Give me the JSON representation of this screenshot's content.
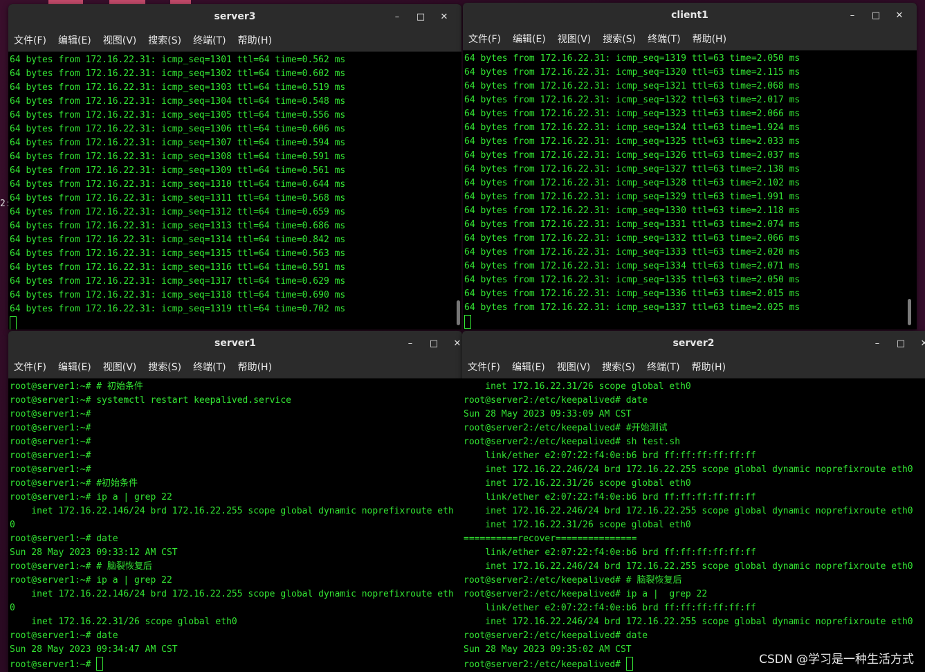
{
  "menu": [
    "文件(F)",
    "编辑(E)",
    "视图(V)",
    "搜索(S)",
    "终端(T)",
    "帮助(H)"
  ],
  "controls": {
    "minimize": "–",
    "maximize": "□",
    "close": "✕"
  },
  "stray_char": "2:",
  "watermark": "CSDN @学习是一种生活方式",
  "windows": {
    "server3": {
      "title": "server3",
      "lines": [
        "64 bytes from 172.16.22.31: icmp_seq=1301 ttl=64 time=0.562 ms",
        "64 bytes from 172.16.22.31: icmp_seq=1302 ttl=64 time=0.602 ms",
        "64 bytes from 172.16.22.31: icmp_seq=1303 ttl=64 time=0.519 ms",
        "64 bytes from 172.16.22.31: icmp_seq=1304 ttl=64 time=0.548 ms",
        "64 bytes from 172.16.22.31: icmp_seq=1305 ttl=64 time=0.556 ms",
        "64 bytes from 172.16.22.31: icmp_seq=1306 ttl=64 time=0.606 ms",
        "64 bytes from 172.16.22.31: icmp_seq=1307 ttl=64 time=0.594 ms",
        "64 bytes from 172.16.22.31: icmp_seq=1308 ttl=64 time=0.591 ms",
        "64 bytes from 172.16.22.31: icmp_seq=1309 ttl=64 time=0.561 ms",
        "64 bytes from 172.16.22.31: icmp_seq=1310 ttl=64 time=0.644 ms",
        "64 bytes from 172.16.22.31: icmp_seq=1311 ttl=64 time=0.568 ms",
        "64 bytes from 172.16.22.31: icmp_seq=1312 ttl=64 time=0.659 ms",
        "64 bytes from 172.16.22.31: icmp_seq=1313 ttl=64 time=0.686 ms",
        "64 bytes from 172.16.22.31: icmp_seq=1314 ttl=64 time=0.842 ms",
        "64 bytes from 172.16.22.31: icmp_seq=1315 ttl=64 time=0.563 ms",
        "64 bytes from 172.16.22.31: icmp_seq=1316 ttl=64 time=0.591 ms",
        "64 bytes from 172.16.22.31: icmp_seq=1317 ttl=64 time=0.629 ms",
        "64 bytes from 172.16.22.31: icmp_seq=1318 ttl=64 time=0.690 ms",
        "64 bytes from 172.16.22.31: icmp_seq=1319 ttl=64 time=0.702 ms"
      ],
      "prompt": ""
    },
    "client1": {
      "title": "client1",
      "lines": [
        "64 bytes from 172.16.22.31: icmp_seq=1319 ttl=63 time=2.050 ms",
        "64 bytes from 172.16.22.31: icmp_seq=1320 ttl=63 time=2.115 ms",
        "64 bytes from 172.16.22.31: icmp_seq=1321 ttl=63 time=2.068 ms",
        "64 bytes from 172.16.22.31: icmp_seq=1322 ttl=63 time=2.017 ms",
        "64 bytes from 172.16.22.31: icmp_seq=1323 ttl=63 time=2.066 ms",
        "64 bytes from 172.16.22.31: icmp_seq=1324 ttl=63 time=1.924 ms",
        "64 bytes from 172.16.22.31: icmp_seq=1325 ttl=63 time=2.033 ms",
        "64 bytes from 172.16.22.31: icmp_seq=1326 ttl=63 time=2.037 ms",
        "64 bytes from 172.16.22.31: icmp_seq=1327 ttl=63 time=2.138 ms",
        "64 bytes from 172.16.22.31: icmp_seq=1328 ttl=63 time=2.102 ms",
        "64 bytes from 172.16.22.31: icmp_seq=1329 ttl=63 time=1.991 ms",
        "64 bytes from 172.16.22.31: icmp_seq=1330 ttl=63 time=2.118 ms",
        "64 bytes from 172.16.22.31: icmp_seq=1331 ttl=63 time=2.074 ms",
        "64 bytes from 172.16.22.31: icmp_seq=1332 ttl=63 time=2.066 ms",
        "64 bytes from 172.16.22.31: icmp_seq=1333 ttl=63 time=2.020 ms",
        "64 bytes from 172.16.22.31: icmp_seq=1334 ttl=63 time=2.071 ms",
        "64 bytes from 172.16.22.31: icmp_seq=1335 ttl=63 time=2.050 ms",
        "64 bytes from 172.16.22.31: icmp_seq=1336 ttl=63 time=2.015 ms",
        "64 bytes from 172.16.22.31: icmp_seq=1337 ttl=63 time=2.025 ms"
      ],
      "prompt": ""
    },
    "server1": {
      "title": "server1",
      "lines": [
        "root@server1:~# # 初始条件",
        "root@server1:~# systemctl restart keepalived.service",
        "root@server1:~#",
        "root@server1:~#",
        "root@server1:~#",
        "root@server1:~#",
        "root@server1:~#",
        "root@server1:~# #初始条件",
        "root@server1:~# ip a | grep 22",
        "    inet 172.16.22.146/24 brd 172.16.22.255 scope global dynamic noprefixroute eth",
        "0",
        "root@server1:~# date",
        "Sun 28 May 2023 09:33:12 AM CST",
        "root@server1:~# # 脑裂恢复后",
        "root@server1:~# ip a | grep 22",
        "    inet 172.16.22.146/24 brd 172.16.22.255 scope global dynamic noprefixroute eth",
        "0",
        "    inet 172.16.22.31/26 scope global eth0",
        "root@server1:~# date",
        "Sun 28 May 2023 09:34:47 AM CST"
      ],
      "prompt": "root@server1:~# "
    },
    "server2": {
      "title": "server2",
      "lines": [
        "    inet 172.16.22.31/26 scope global eth0",
        "root@server2:/etc/keepalived# date",
        "Sun 28 May 2023 09:33:09 AM CST",
        "root@server2:/etc/keepalived# #开始测试",
        "root@server2:/etc/keepalived# sh test.sh",
        "    link/ether e2:07:22:f4:0e:b6 brd ff:ff:ff:ff:ff:ff",
        "    inet 172.16.22.246/24 brd 172.16.22.255 scope global dynamic noprefixroute eth0",
        "    inet 172.16.22.31/26 scope global eth0",
        "    link/ether e2:07:22:f4:0e:b6 brd ff:ff:ff:ff:ff:ff",
        "    inet 172.16.22.246/24 brd 172.16.22.255 scope global dynamic noprefixroute eth0",
        "    inet 172.16.22.31/26 scope global eth0",
        "==========recover===============",
        "    link/ether e2:07:22:f4:0e:b6 brd ff:ff:ff:ff:ff:ff",
        "    inet 172.16.22.246/24 brd 172.16.22.255 scope global dynamic noprefixroute eth0",
        "root@server2:/etc/keepalived# # 脑裂恢复后",
        "root@server2:/etc/keepalived# ip a |  grep 22",
        "    link/ether e2:07:22:f4:0e:b6 brd ff:ff:ff:ff:ff:ff",
        "    inet 172.16.22.246/24 brd 172.16.22.255 scope global dynamic noprefixroute eth0",
        "root@server2:/etc/keepalived# date",
        "Sun 28 May 2023 09:35:02 AM CST"
      ],
      "prompt": "root@server2:/etc/keepalived# "
    }
  }
}
